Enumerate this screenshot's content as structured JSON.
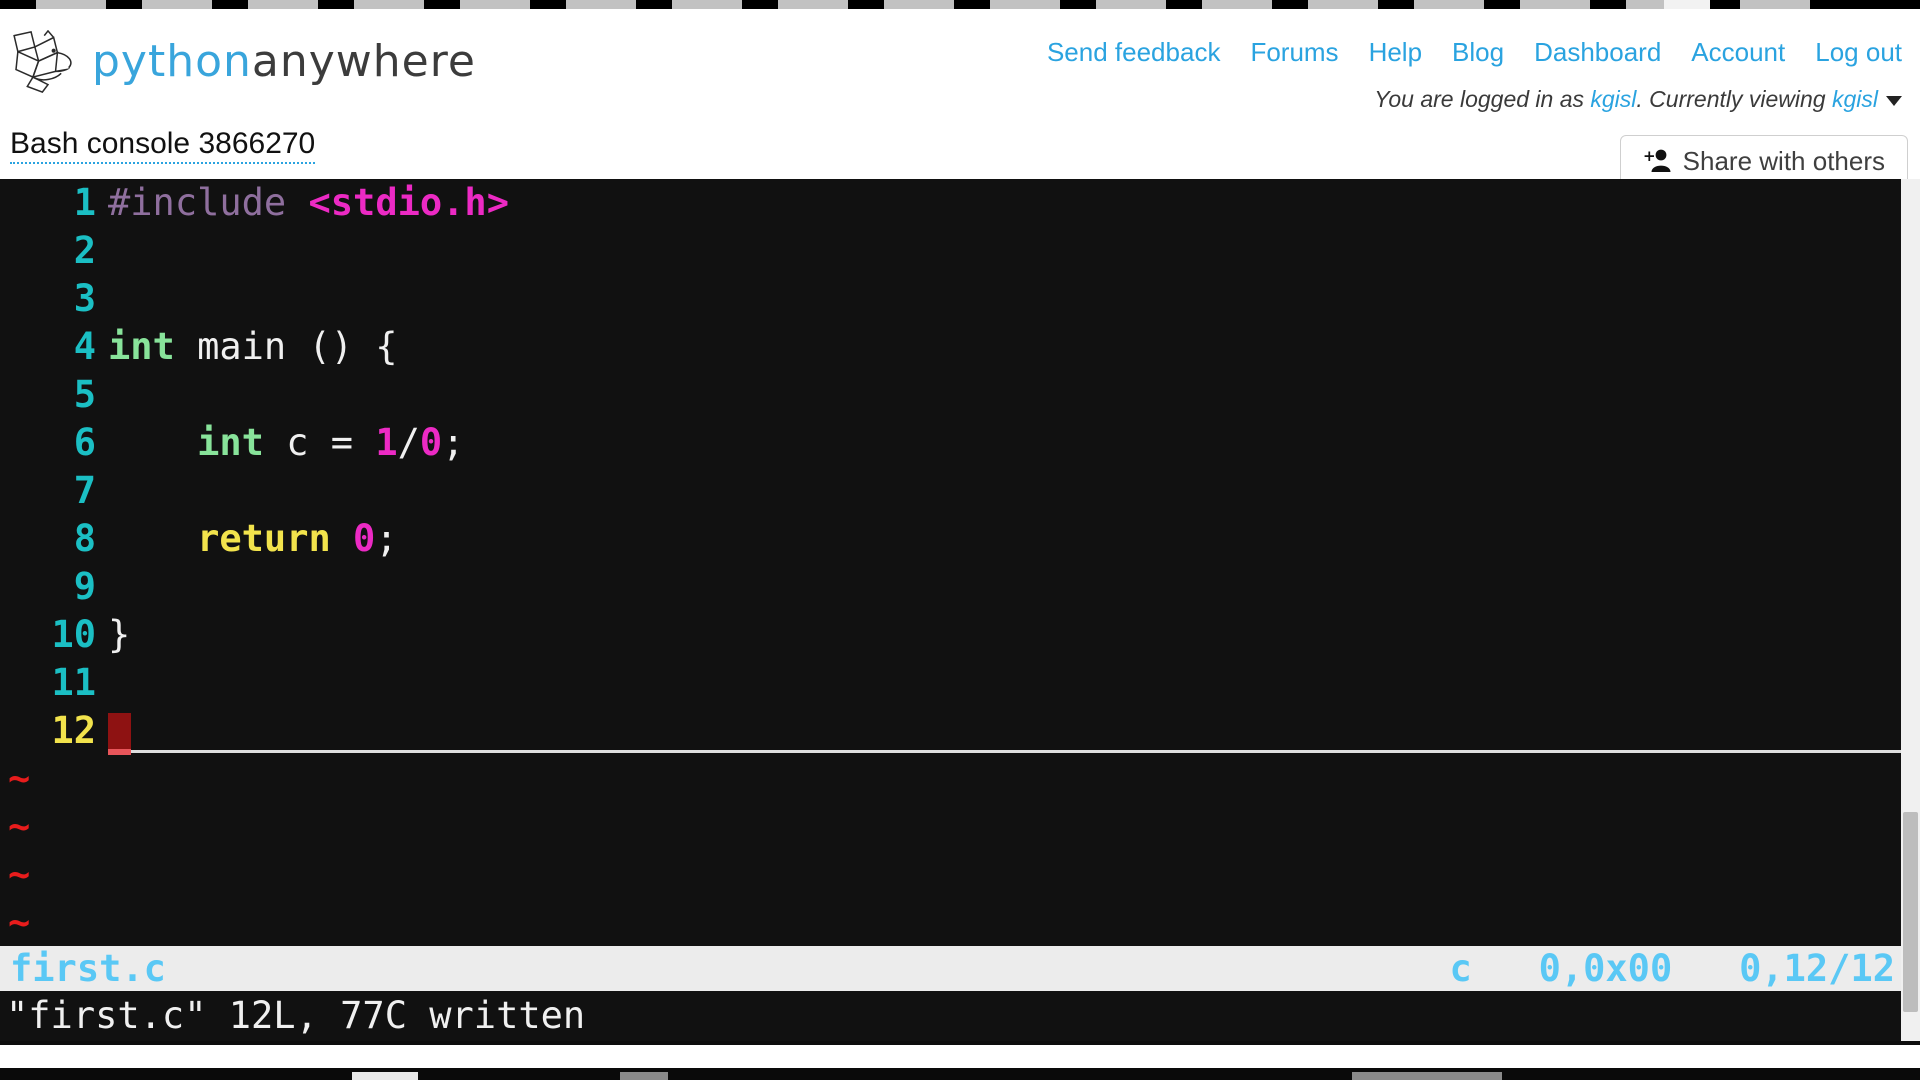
{
  "brand": {
    "name_part1": "python",
    "name_part2": "anywhere",
    "logo_icon": "pythonanywhere-logo-icon"
  },
  "nav": {
    "links": [
      {
        "label": "Send feedback"
      },
      {
        "label": "Forums"
      },
      {
        "label": "Help"
      },
      {
        "label": "Blog"
      },
      {
        "label": "Dashboard"
      },
      {
        "label": "Account"
      },
      {
        "label": "Log out"
      }
    ]
  },
  "session": {
    "prefix": "You are logged in as ",
    "user": "kgisl",
    "middle": ". Currently viewing ",
    "viewing_user": "kgisl",
    "caret_icon": "chevron-down-icon"
  },
  "console": {
    "title": "Bash console 3866270",
    "share_label": "Share with others",
    "share_icon": "add-person-icon"
  },
  "editor": {
    "lines": [
      {
        "num": "1",
        "current": false
      },
      {
        "num": "2",
        "current": false
      },
      {
        "num": "3",
        "current": false
      },
      {
        "num": "4",
        "current": false
      },
      {
        "num": "5",
        "current": false
      },
      {
        "num": "6",
        "current": false
      },
      {
        "num": "7",
        "current": false
      },
      {
        "num": "8",
        "current": false
      },
      {
        "num": "9",
        "current": false
      },
      {
        "num": "10",
        "current": false
      },
      {
        "num": "11",
        "current": false
      },
      {
        "num": "12",
        "current": true
      }
    ],
    "code": {
      "l1_include": "#include",
      "l1_header": "<stdio.h>",
      "l4_type": "int",
      "l4_rest": " main () {",
      "l6_indent": "    ",
      "l6_type": "int",
      "l6_mid": " c = ",
      "l6_num1": "1",
      "l6_slash": "/",
      "l6_num2": "0",
      "l6_semi": ";",
      "l8_indent": "    ",
      "l8_kw": "return",
      "l8_space": " ",
      "l8_num": "0",
      "l8_semi": ";",
      "l10_brace": "}"
    },
    "empty_markers": [
      "~",
      "~",
      "~",
      "~"
    ],
    "statusline": {
      "filename": "first.c",
      "filetype": "c",
      "byte_info": "0,0x00",
      "position": "0,12/12"
    },
    "message": "\"first.c\" 12L, 77C written"
  },
  "colors": {
    "brand_blue": "#39a5dc",
    "link_blue": "#2aa3e0",
    "terminal_bg": "#111111",
    "line_number": "#1bbfc4",
    "current_line_number": "#f2e34c",
    "preproc": "#8f6f9e",
    "string": "#ec2ac4",
    "type_keyword": "#88e39a",
    "statement_keyword": "#f2e34c",
    "number": "#ec2ac4",
    "plain_text": "#f0f0f0",
    "tilde": "#e81c1c",
    "cursor_block": "#8e1212",
    "statusbar_bg": "#ececec",
    "statusbar_fg": "#5ac8f5"
  }
}
